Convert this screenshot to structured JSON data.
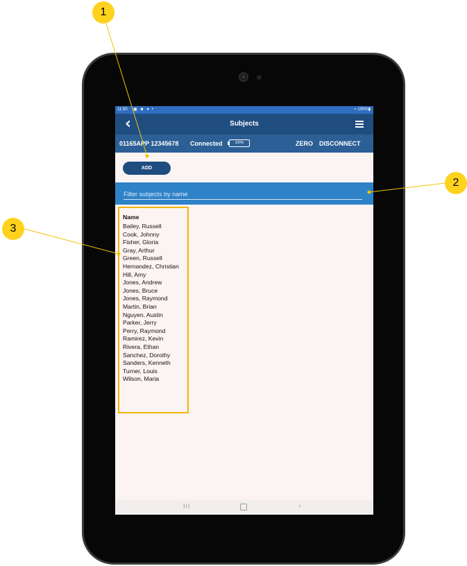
{
  "status_bar": {
    "time": "11:50",
    "icons": "▣ ☻ ● •",
    "battery": "≈ 100%▮"
  },
  "app_bar": {
    "back_icon": "back-chevron-icon",
    "title": "Subjects",
    "menu_icon": "hamburger-menu-icon"
  },
  "device_bar": {
    "device_id": "01165APP 12345678",
    "connection_status": "Connected",
    "battery_level": "100%",
    "zero_label": "ZERO",
    "disconnect_label": "DISCONNECT"
  },
  "add_button": {
    "label": "ADD"
  },
  "filter": {
    "placeholder": "Filter subjects by name"
  },
  "subject_table": {
    "column_header": "Name",
    "rows": [
      "Bailey, Russell",
      "Cook, Johnny",
      "Fisher, Gloria",
      "Gray, Arthur",
      "Green, Russell",
      "Hernandez, Christian",
      "Hill, Amy",
      "Jones, Andrew",
      "Jones, Bruce",
      "Jones, Raymond",
      "Martin, Brian",
      "Nguyen, Austin",
      "Parker, Jerry",
      "Perry, Raymond",
      "Ramirez, Kevin",
      "Rivera, Ethan",
      "Sanchez, Dorothy",
      "Sanders, Kenneth",
      "Turner, Louis",
      "Wilson, Maria"
    ]
  },
  "nav_bar": {
    "recents": "III",
    "back": "‹"
  },
  "callouts": [
    "1",
    "2",
    "3"
  ],
  "colors": {
    "app_bar": "#1f4d80",
    "device_bar": "#2c5f95",
    "filter_bar": "#2d82c8",
    "callout": "#ffd21e",
    "highlight": "#f2b400"
  }
}
